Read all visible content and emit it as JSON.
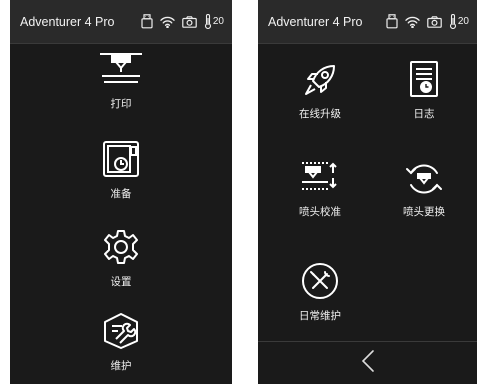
{
  "left": {
    "status": {
      "title": "Adventurer 4 Pro",
      "temperature": "20"
    },
    "menu": [
      {
        "label": "打印",
        "icon": "print-icon"
      },
      {
        "label": "准备",
        "icon": "prepare-icon"
      },
      {
        "label": "设置",
        "icon": "settings-gear-icon"
      },
      {
        "label": "维护",
        "icon": "maintenance-icon"
      }
    ]
  },
  "right": {
    "status": {
      "title": "Adventurer 4 Pro",
      "temperature": "20"
    },
    "menu": [
      {
        "label": "在线升级",
        "icon": "rocket-icon"
      },
      {
        "label": "日志",
        "icon": "log-document-icon"
      },
      {
        "label": "喷头校准",
        "icon": "nozzle-calibration-icon"
      },
      {
        "label": "喷头更换",
        "icon": "nozzle-replace-icon"
      },
      {
        "label": "日常维护",
        "icon": "wrench-screwdriver-icon"
      }
    ],
    "back_icon": "chevron-left-icon"
  },
  "colors": {
    "screen_bg": "#1a1a1a",
    "statusbar_bg": "#2a2a2a",
    "icon": "#ffffff"
  }
}
